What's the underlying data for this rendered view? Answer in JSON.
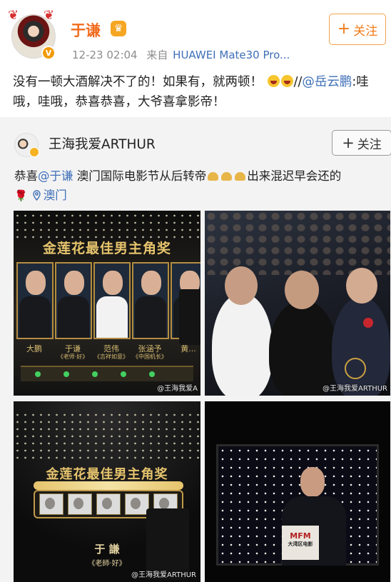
{
  "post": {
    "author": "于谦",
    "time": "12-23 02:04",
    "source_prefix": "来自",
    "source": "HUAWEI Mate30 Pro...",
    "follow_label": "关注",
    "text_part1": "没有一顿大酒解决不了的！如果有，就两顿！",
    "text_part2": "//",
    "mention": "@岳云鹏",
    "text_part3": ":哇哦，哇哦，恭喜恭喜，大爷喜拿影帝！"
  },
  "repost": {
    "author": "王海我爱ARTHUR",
    "follow_label": "关注",
    "text_prefix": "恭喜",
    "mention": "@于谦",
    "text_part1": " 澳门国际电影节从后转帝",
    "text_part2": "出来混迟早会还的",
    "location": "澳门",
    "photos": [
      {
        "banner": "金莲花最佳男主角奖",
        "nominees": [
          "大鹏",
          "于谦",
          "范伟",
          "张涵予",
          "黄..."
        ],
        "nominee_subs": [
          "",
          "《老师·好》",
          "《吉祥如意》",
          "《中国机长》",
          ""
        ],
        "watermark": "@王海我爱A"
      },
      {
        "watermark": "@王海我爱ARTHUR"
      },
      {
        "banner": "金莲花最佳男主角奖",
        "winner": "于 謙",
        "winner_film": "《老師·好》",
        "watermark": "@王海我爱ARTHUR"
      },
      {
        "podium_brand": "MFM",
        "podium_sub": "大湾区电影"
      }
    ]
  },
  "colors": {
    "accent_orange": "#f26b1d",
    "link_blue": "#3f6fb7",
    "repost_bg": "#f3f3f3"
  }
}
